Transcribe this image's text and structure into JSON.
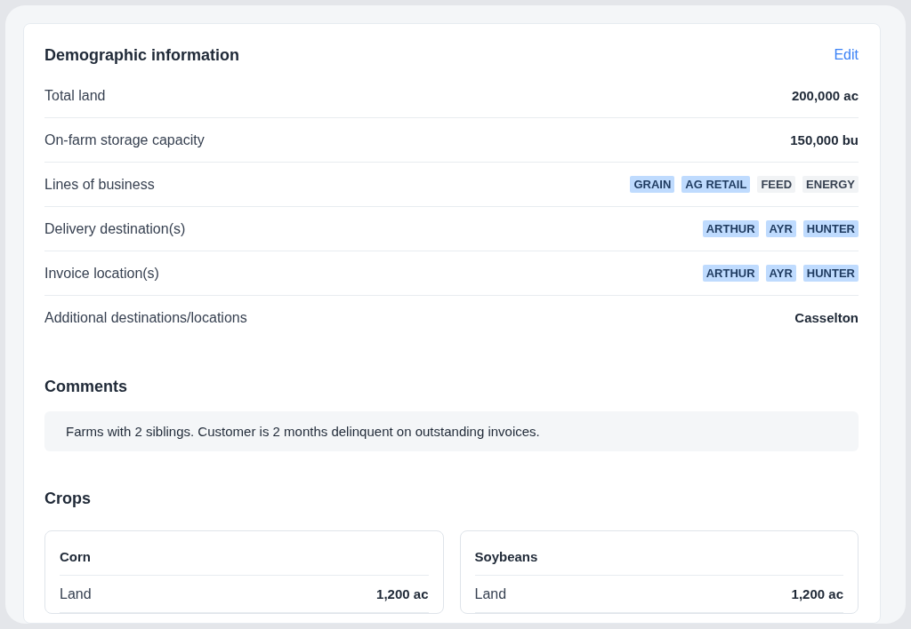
{
  "demographics": {
    "title": "Demographic information",
    "edit_link": "Edit",
    "rows": [
      {
        "kind": "value",
        "label": "Total land",
        "value": "200,000 ac"
      },
      {
        "kind": "value",
        "label": "On-farm storage capacity",
        "value": "150,000 bu"
      },
      {
        "kind": "tags",
        "label": "Lines of business",
        "tags": [
          {
            "text": "GRAIN",
            "selected": true
          },
          {
            "text": "AG RETAIL",
            "selected": true
          },
          {
            "text": "FEED",
            "selected": false
          },
          {
            "text": "ENERGY",
            "selected": false
          }
        ]
      },
      {
        "kind": "tags",
        "label": "Delivery destination(s)",
        "tags": [
          {
            "text": "ARTHUR",
            "selected": true
          },
          {
            "text": "AYR",
            "selected": true
          },
          {
            "text": "HUNTER",
            "selected": true
          }
        ]
      },
      {
        "kind": "tags",
        "label": "Invoice location(s)",
        "tags": [
          {
            "text": "ARTHUR",
            "selected": true
          },
          {
            "text": "AYR",
            "selected": true
          },
          {
            "text": "HUNTER",
            "selected": true
          }
        ]
      },
      {
        "kind": "value",
        "label": "Additional destinations/locations",
        "value": "Casselton"
      }
    ]
  },
  "comments": {
    "title": "Comments",
    "text": "Farms with 2 siblings. Customer is 2 months delinquent on outstanding invoices."
  },
  "crops": {
    "title": "Crops",
    "cards": [
      {
        "name": "Corn",
        "rows": [
          {
            "label": "Land",
            "value": "1,200 ac"
          }
        ]
      },
      {
        "name": "Soybeans",
        "rows": [
          {
            "label": "Land",
            "value": "1,200 ac"
          }
        ]
      }
    ]
  }
}
